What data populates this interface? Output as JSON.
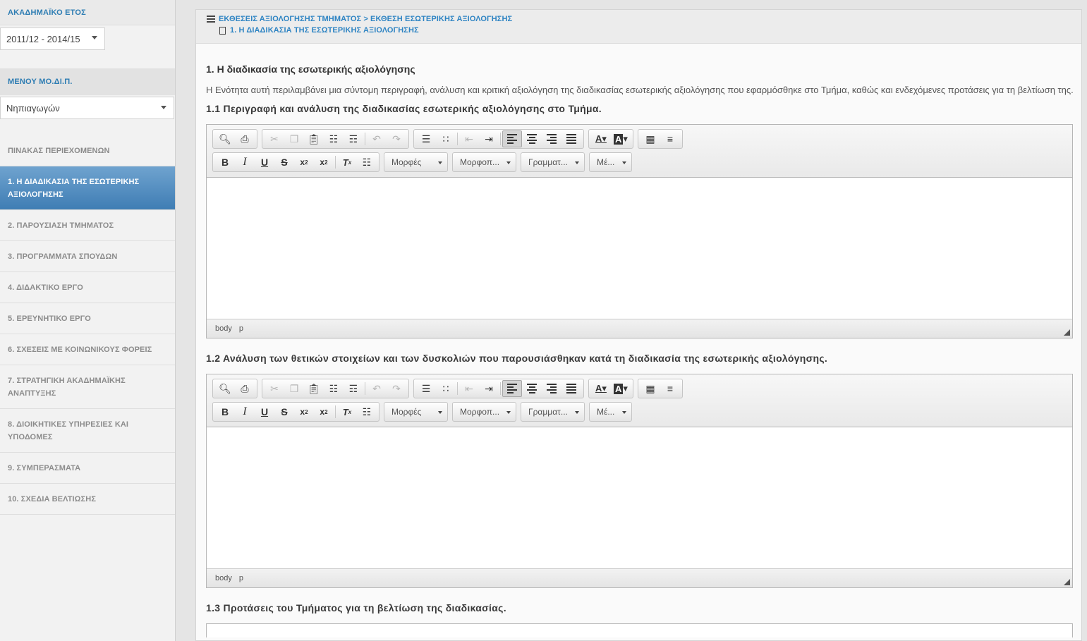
{
  "sidebar": {
    "year_header": "ΑΚΑΔΗΜΑΪΚΟ ΕΤΟΣ",
    "year_value": "2011/12 - 2014/15",
    "menu_header": "ΜΕΝΟΥ ΜΟ.ΔΙ.Π.",
    "dept_value": "Νηπιαγωγών",
    "items": [
      {
        "label": "ΠΙΝΑΚΑΣ ΠΕΡΙΕΧΟΜΕΝΩΝ"
      },
      {
        "label": "1. Η ΔΙΑΔΙΚΑΣΙΑ ΤΗΣ ΕΣΩΤΕΡΙΚΗΣ ΑΞΙΟΛΟΓΗΣΗΣ"
      },
      {
        "label": "2. ΠΑΡΟΥΣΙΑΣΗ ΤΜΗΜΑΤΟΣ"
      },
      {
        "label": "3. ΠΡΟΓΡΑΜΜΑΤΑ ΣΠΟΥΔΩΝ"
      },
      {
        "label": "4. ΔΙΔΑΚΤΙΚΟ ΕΡΓΟ"
      },
      {
        "label": "5. ΕΡΕΥΝΗΤΙΚΟ ΕΡΓΟ"
      },
      {
        "label": "6. ΣΧΕΣΕΙΣ ΜΕ ΚΟΙΝΩΝΙΚΟΥΣ ΦΟΡΕΙΣ"
      },
      {
        "label": "7. ΣΤΡΑΤΗΓΙΚΗ ΑΚΑΔΗΜΑΪΚΗΣ ΑΝΑΠΤΥΞΗΣ"
      },
      {
        "label": "8. ΔΙΟΙΚΗΤΙΚΕΣ ΥΠΗΡΕΣΙΕΣ ΚΑΙ ΥΠΟΔΟΜΕΣ"
      },
      {
        "label": "9. ΣΥΜΠΕΡΑΣΜΑΤΑ"
      },
      {
        "label": "10. ΣΧΕΔΙΑ ΒΕΛΤΙΩΣΗΣ"
      }
    ]
  },
  "breadcrumb": {
    "path": "ΕΚΘΕΣΕΙΣ ΑΞΙΟΛΟΓΗΣΗΣ ΤΜΗΜΑΤΟΣ > ΕΚΘΕΣΗ ΕΣΩΤΕΡΙΚΗΣ ΑΞΙΟΛΟΓΗΣΗΣ",
    "current": "1. Η ΔΙΑΔΙΚΑΣΙΑ ΤΗΣ ΕΣΩΤΕΡΙΚΗΣ ΑΞΙΟΛΟΓΗΣΗΣ"
  },
  "main": {
    "title": "1. Η διαδικασία της εσωτερικής αξιολόγησης",
    "intro": "Η Ενότητα αυτή περιλαμβάνει μια σύντομη περιγραφή, ανάλυση και κριτική αξιολόγηση της διαδικασίας εσωτερικής αξιολόγησης που εφαρμόσθηκε στο Τμήμα, καθώς και ενδεχόμενες προτάσεις για τη βελτίωση της.",
    "q1": "1.1 Περιγραφή και ανάλυση της διαδικασίας εσωτερικής αξιολόγησης στο Τμήμα.",
    "q2": "1.2 Ανάλυση των θετικών στοιχείων και των δυσκολιών που παρουσιάσθηκαν κατά τη διαδικασία της εσωτερικής αξιολόγησης.",
    "q3": "1.3 Προτάσεις του Τμήματος για τη βελτίωση της διαδικασίας."
  },
  "editor": {
    "drop_styles": "Μορφές",
    "drop_format": "Μορφοπ...",
    "drop_font": "Γραμματ...",
    "drop_size": "Μέ...",
    "status_body": "body",
    "status_p": "p",
    "icons": [
      "preview-icon",
      "print-icon",
      "cut-icon",
      "copy-icon",
      "paste-icon",
      "paste-text-icon",
      "paste-word-icon",
      "undo-icon",
      "redo-icon",
      "numbered-list-icon",
      "bulleted-list-icon",
      "outdent-icon",
      "indent-icon",
      "align-left-icon",
      "align-center-icon",
      "align-right-icon",
      "justify-icon",
      "text-color-icon",
      "background-color-icon",
      "table-icon",
      "horizontal-line-icon",
      "bold-icon",
      "italic-icon",
      "underline-icon",
      "strike-icon",
      "subscript-icon",
      "superscript-icon",
      "remove-format-icon",
      "source-icon"
    ]
  }
}
